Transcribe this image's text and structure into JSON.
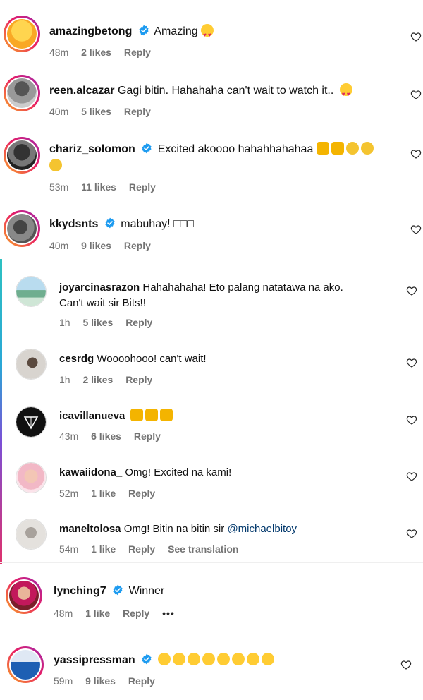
{
  "comments": [
    {
      "username": "amazingbetong",
      "verified": true,
      "text": "Amazing",
      "emojis": [
        "heart-eyes"
      ],
      "time": "48m",
      "likes": "2 likes",
      "reply": "Reply"
    },
    {
      "username": "reen.alcazar",
      "verified": false,
      "text": "Gagi bitin. Hahahaha can't wait to watch it..",
      "emojis": [
        "heart-eyes"
      ],
      "time": "40m",
      "likes": "5 likes",
      "reply": "Reply"
    },
    {
      "username": "chariz_solomon",
      "verified": true,
      "text": "Excited akoooo hahahhahahaa",
      "emojis": [
        "raised-hands",
        "raised-hands",
        "clap",
        "clap",
        "clap"
      ],
      "time": "53m",
      "likes": "11 likes",
      "reply": "Reply"
    },
    {
      "username": "kkydsnts",
      "verified": true,
      "text": "mabuhay! □□□",
      "emojis": [],
      "time": "40m",
      "likes": "9 likes",
      "reply": "Reply"
    }
  ],
  "replies": [
    {
      "username": "joyarcinasrazon",
      "text": "Hahahahaha! Eto palang natatawa na ako.",
      "text2": "Can't wait sir Bits!!",
      "time": "1h",
      "likes": "5 likes",
      "reply": "Reply"
    },
    {
      "username": "cesrdg",
      "text": "Woooohooo! can't wait!",
      "time": "1h",
      "likes": "2 likes",
      "reply": "Reply"
    },
    {
      "username": "icavillanueva",
      "text": "",
      "emojis": [
        "raised-hands",
        "raised-hands",
        "raised-hands"
      ],
      "time": "43m",
      "likes": "6 likes",
      "reply": "Reply"
    },
    {
      "username": "kawaiidona_",
      "text": "Omg! Excited na kami!",
      "time": "52m",
      "likes": "1 like",
      "reply": "Reply"
    },
    {
      "username": "maneltolosa",
      "text": "Omg! Bitin na bitin sir",
      "mention": "@michaelbitoy",
      "time": "54m",
      "likes": "1 like",
      "reply": "Reply",
      "translate": "See translation"
    }
  ],
  "bottom": [
    {
      "username": "lynching7",
      "verified": true,
      "text": "Winner",
      "time": "48m",
      "likes": "1 like",
      "reply": "Reply",
      "more": "•••"
    },
    {
      "username": "yassipressman",
      "verified": true,
      "text": "",
      "emojis": [
        "joy",
        "joy",
        "joy",
        "joy",
        "joy",
        "joy",
        "joy",
        "joy"
      ],
      "time": "59m",
      "likes": "9 likes",
      "reply": "Reply"
    }
  ],
  "colors": {
    "verified": "#1d9bf0",
    "meta": "#737373",
    "mention": "#00376b"
  }
}
